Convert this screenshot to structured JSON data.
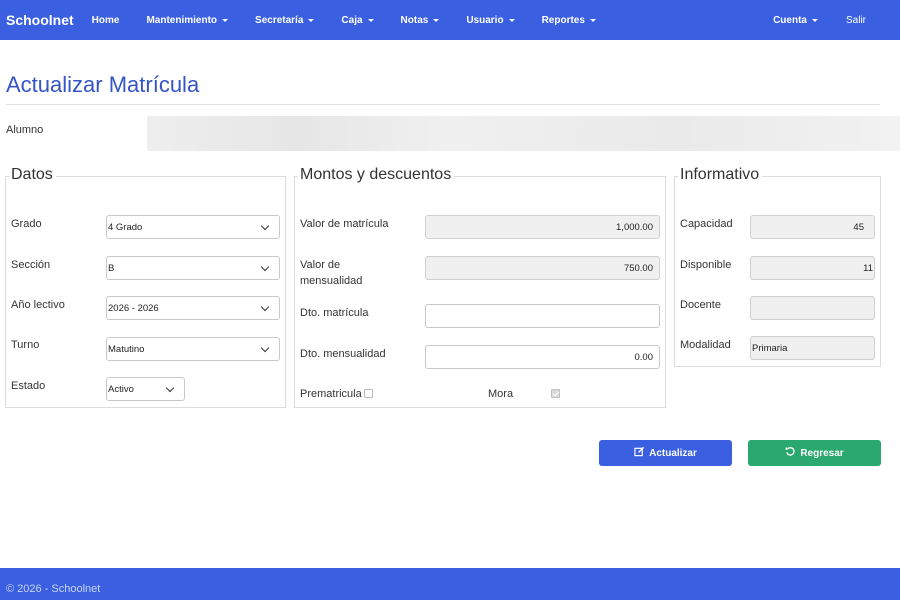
{
  "navbar": {
    "brand": "Schoolnet",
    "items": [
      {
        "label": "Home",
        "dropdown": false
      },
      {
        "label": "Mantenimiento",
        "dropdown": true
      },
      {
        "label": "Secretaría",
        "dropdown": true
      },
      {
        "label": "Caja",
        "dropdown": true
      },
      {
        "label": "Notas",
        "dropdown": true
      },
      {
        "label": "Usuario",
        "dropdown": true
      },
      {
        "label": "Reportes",
        "dropdown": true
      }
    ],
    "cuenta": "Cuenta",
    "salir": "Salir",
    "color": "#3a5fe0"
  },
  "page": {
    "title": "Actualizar Matrícula",
    "alumno_label": "Alumno"
  },
  "datos": {
    "legend": "Datos",
    "grado_label": "Grado",
    "grado_value": "4 Grado",
    "seccion_label": "Sección",
    "seccion_value": "B",
    "anio_label": "Año lectivo",
    "anio_value": "2026 - 2026",
    "turno_label": "Turno",
    "turno_value": "Matutino",
    "estado_label": "Estado",
    "estado_value": "Activo"
  },
  "montos": {
    "legend": "Montos y descuentos",
    "valor_matricula_label": "Valor de matrícula",
    "valor_matricula_value": "1,000.00",
    "valor_mensualidad_label": "Valor de mensualidad",
    "valor_mensualidad_value": "750.00",
    "dto_matricula_label": "Dto. matrícula",
    "dto_matricula_value": "",
    "dto_mensualidad_label": "Dto. mensualidad",
    "dto_mensualidad_value": "0.00",
    "prematricula_label": "Prematricula",
    "prematricula_checked": false,
    "mora_label": "Mora",
    "mora_checked": true
  },
  "informativo": {
    "legend": "Informativo",
    "capacidad_label": "Capacidad",
    "capacidad_value": "45",
    "disponible_label": "Disponible",
    "disponible_value": "11",
    "docente_label": "Docente",
    "docente_value": "",
    "modalidad_label": "Modalidad",
    "modalidad_value": "Primaria"
  },
  "buttons": {
    "actualizar": "Actualizar",
    "regresar": "Regresar",
    "primary_color": "#3a5fe0",
    "success_color": "#2aa86e"
  },
  "footer": {
    "text": "© 2026 - Schoolnet"
  }
}
